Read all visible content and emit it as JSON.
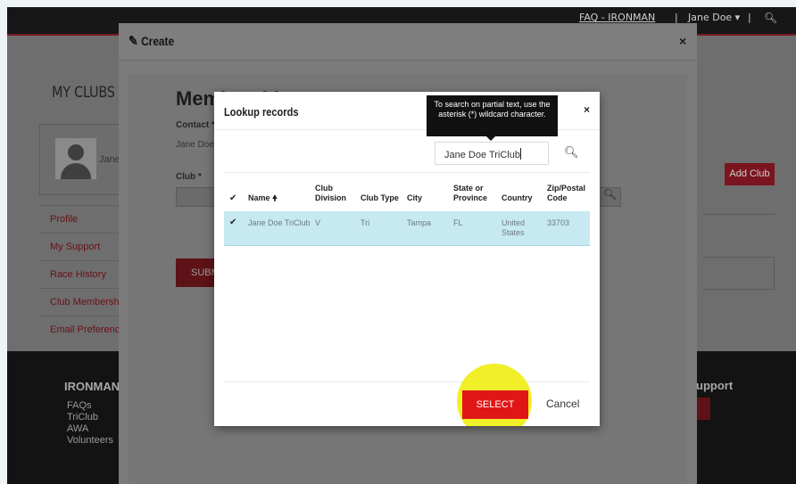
{
  "topnav": {
    "faq_link": "FAQ - IRONMAN",
    "divider": "|",
    "user_menu": "Jane Doe ▾",
    "search_icon": "search-icon"
  },
  "page": {
    "title": "MY CLUBS",
    "profile_name": "Jane",
    "side_menu": [
      "Profile",
      "My Support",
      "Race History",
      "Club Membership",
      "Email Preferences"
    ],
    "add_club_label": "Add Club"
  },
  "footer": {
    "title": "IRONMAN",
    "links": [
      "FAQs",
      "TriClub",
      "AWA",
      "Volunteers"
    ],
    "support_title": "upport"
  },
  "create_modal": {
    "title": "Create",
    "close": "×",
    "form_title": "Membership",
    "contact_label": "Contact *",
    "contact_value": "Jane Doe",
    "club_label": "Club *",
    "submit_label": "SUBMIT"
  },
  "lookup": {
    "title": "Lookup records",
    "close": "×",
    "search_value": "Jane Doe TriClub",
    "tooltip": "To search on partial text, use the asterisk (*) wildcard character.",
    "columns": {
      "name": "Name",
      "division_line1": "Club",
      "division_line2": "Division",
      "club_type": "Club Type",
      "city": "City",
      "state_line1": "State or",
      "state_line2": "Province",
      "country": "Country",
      "zip_line1": "Zip/Postal",
      "zip_line2": "Code"
    },
    "row": {
      "name": "Jane Doe TriClub",
      "division": "V",
      "club_type": "Tri",
      "city": "Tampa",
      "state": "FL",
      "country_line1": "United",
      "country_line2": "States",
      "zip": "33703"
    },
    "select_label": "SELECT",
    "cancel_label": "Cancel"
  },
  "colors": {
    "select_button": "#e01616",
    "selected_row": "#c7e9f1",
    "highlight": "#f0ee15"
  }
}
